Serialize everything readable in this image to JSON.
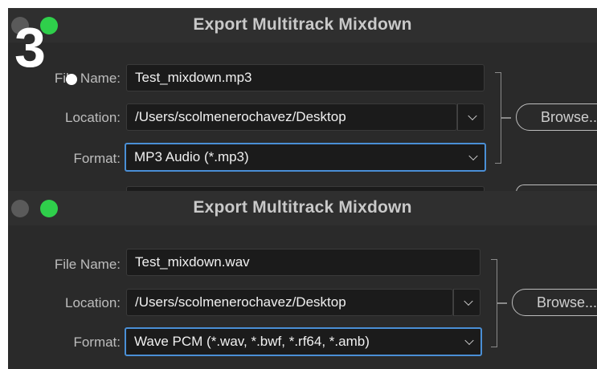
{
  "step_number": "3",
  "step_dot": ".",
  "panels": [
    {
      "title": "Export Multitrack Mixdown",
      "file_name_label": "File Name:",
      "file_name_value": "Test_mixdown.mp3",
      "location_label": "Location:",
      "location_value": "/Users/scolmenerochavez/Desktop",
      "format_label": "Format:",
      "format_value": "MP3 Audio (*.mp3)",
      "browse_label": "Browse..."
    },
    {
      "title": "Export Multitrack Mixdown",
      "file_name_label": "File Name:",
      "file_name_value": "Test_mixdown.wav",
      "location_label": "Location:",
      "location_value": "/Users/scolmenerochavez/Desktop",
      "format_label": "Format:",
      "format_value": "Wave PCM (*.wav, *.bwf, *.rf64, *.amb)",
      "browse_label": "Browse..."
    }
  ],
  "colors": {
    "panel_bg": "#2a2a2a",
    "field_bg": "#1b1b1b",
    "focus_border": "#4a8fd6",
    "traffic_green": "#2fcf4b"
  },
  "icons": [
    "chevron-down-icon"
  ]
}
